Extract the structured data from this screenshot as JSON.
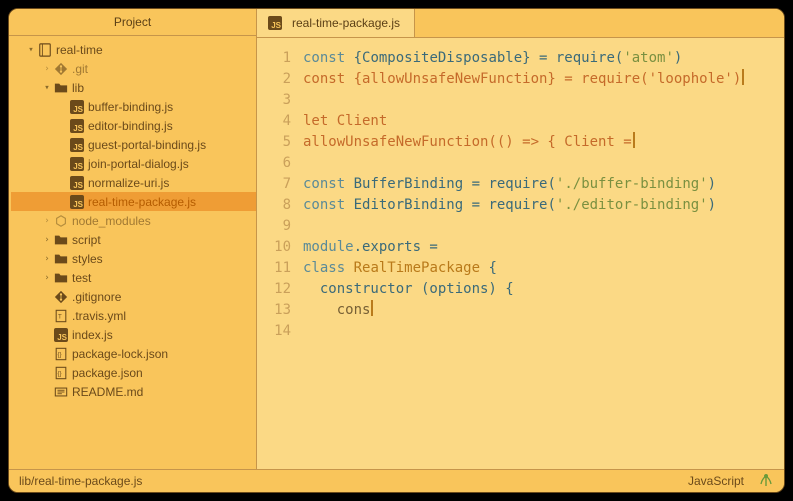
{
  "sidebar": {
    "title": "Project",
    "tree": {
      "root": {
        "name": "real-time",
        "expanded": true,
        "kind": "repo"
      },
      "children": [
        {
          "name": ".git",
          "kind": "git",
          "expanded": false,
          "depth": 2,
          "faded": true
        },
        {
          "name": "lib",
          "kind": "folder",
          "expanded": true,
          "depth": 2
        },
        {
          "name": "buffer-binding.js",
          "kind": "js",
          "depth": 3
        },
        {
          "name": "editor-binding.js",
          "kind": "js",
          "depth": 3
        },
        {
          "name": "guest-portal-binding.js",
          "kind": "js",
          "depth": 3
        },
        {
          "name": "join-portal-dialog.js",
          "kind": "js",
          "depth": 3
        },
        {
          "name": "normalize-uri.js",
          "kind": "js",
          "depth": 3
        },
        {
          "name": "real-time-package.js",
          "kind": "js",
          "depth": 3,
          "selected": true,
          "modified": true
        },
        {
          "name": "node_modules",
          "kind": "node",
          "expanded": false,
          "depth": 2,
          "faded": true
        },
        {
          "name": "script",
          "kind": "folder",
          "expanded": false,
          "depth": 2
        },
        {
          "name": "styles",
          "kind": "folder",
          "expanded": false,
          "depth": 2
        },
        {
          "name": "test",
          "kind": "folder",
          "expanded": false,
          "depth": 2
        },
        {
          "name": ".gitignore",
          "kind": "git",
          "depth": 2
        },
        {
          "name": ".travis.yml",
          "kind": "travis",
          "depth": 2
        },
        {
          "name": "index.js",
          "kind": "js",
          "depth": 2
        },
        {
          "name": "package-lock.json",
          "kind": "json",
          "depth": 2
        },
        {
          "name": "package.json",
          "kind": "json",
          "depth": 2
        },
        {
          "name": "README.md",
          "kind": "md",
          "depth": 2
        }
      ]
    }
  },
  "tab": {
    "title": "real-time-package.js",
    "icon": "js"
  },
  "editor": {
    "lines": [
      {
        "n": 1,
        "html": "<span class='c-key'>const</span> {CompositeDisposable} = <span class='c-fn'>require</span>(<span class='c-str'>'atom'</span>)"
      },
      {
        "n": 2,
        "modified": true,
        "cursor": true,
        "html": "<span class='c-mod'>const {allowUnsafeNewFunction} = require('loophole')</span>"
      },
      {
        "n": 3,
        "html": ""
      },
      {
        "n": 4,
        "modified": true,
        "html": "<span class='c-mod'>let Client</span>"
      },
      {
        "n": 5,
        "modified": true,
        "cursor": true,
        "html": "<span class='c-mod'>allowUnsafeNewFunction(() =&gt; { Client =</span>"
      },
      {
        "n": 6,
        "html": ""
      },
      {
        "n": 7,
        "html": "<span class='c-key'>const</span> BufferBinding = <span class='c-fn'>require</span>(<span class='c-str'>'./buffer-binding'</span>)"
      },
      {
        "n": 8,
        "html": "<span class='c-key'>const</span> EditorBinding = <span class='c-fn'>require</span>(<span class='c-str'>'./editor-binding'</span>)"
      },
      {
        "n": 9,
        "html": ""
      },
      {
        "n": 10,
        "html": "<span class='c-key'>module</span>.exports ="
      },
      {
        "n": 11,
        "html": "<span class='c-key'>class</span> <span class='c-cls'>RealTimePackage</span> {"
      },
      {
        "n": 12,
        "html": "  <span class='c-fn'>constructor</span> (options) {"
      },
      {
        "n": 13,
        "cursor": true,
        "html": "    <span class='c-plain'>cons</span>"
      },
      {
        "n": 14,
        "html": ""
      }
    ]
  },
  "statusbar": {
    "path": "lib/real-time-package.js",
    "language": "JavaScript"
  }
}
